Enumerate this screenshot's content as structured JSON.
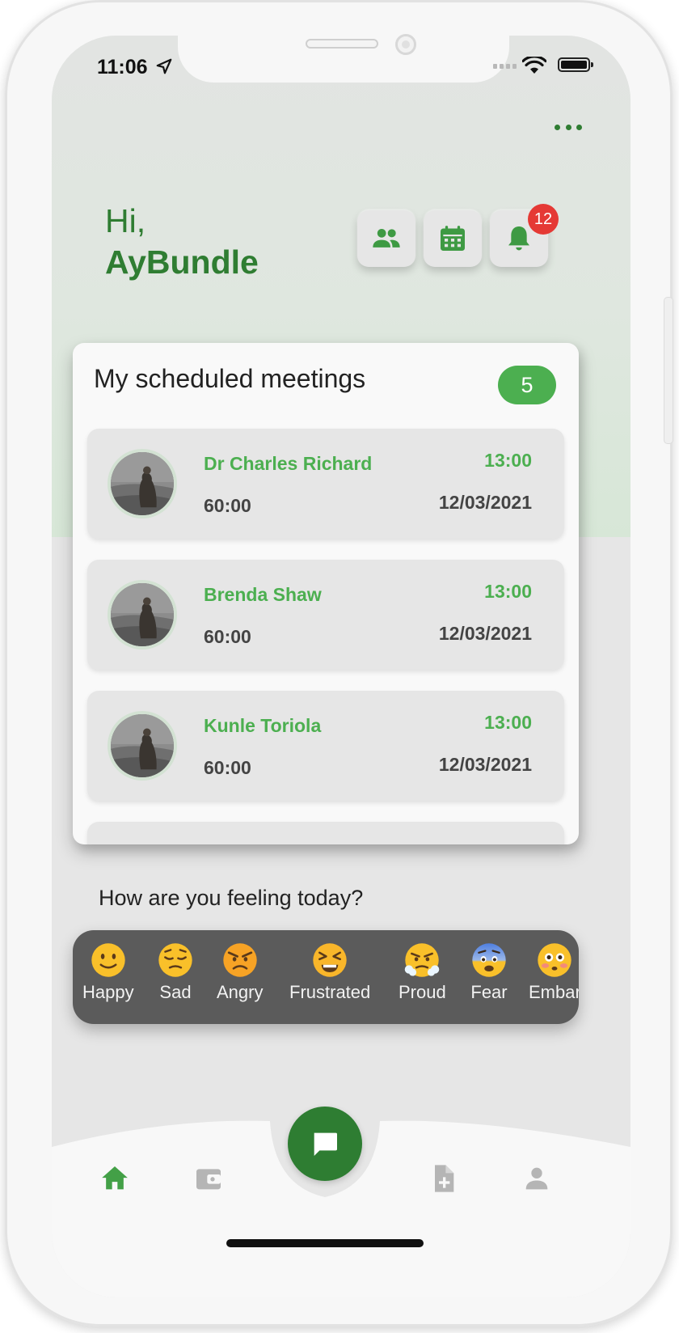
{
  "status_bar": {
    "time": "11:06"
  },
  "header": {
    "greeting": "Hi,",
    "user_name": "AyBundle",
    "notification_count": "12",
    "accent_color": "#2f7d32"
  },
  "meetings": {
    "title": "My scheduled meetings",
    "count": "5",
    "items": [
      {
        "name": "Dr Charles Richard",
        "duration": "60:00",
        "time": "13:00",
        "date": "12/03/2021"
      },
      {
        "name": "Brenda Shaw",
        "duration": "60:00",
        "time": "13:00",
        "date": "12/03/2021"
      },
      {
        "name": "Kunle Toriola",
        "duration": "60:00",
        "time": "13:00",
        "date": "12/03/2021"
      }
    ]
  },
  "feelings": {
    "title": "How are you feeling today?",
    "moods": [
      {
        "label": "Happy",
        "icon": "smile-emoji"
      },
      {
        "label": "Sad",
        "icon": "pensive-emoji"
      },
      {
        "label": "Angry",
        "icon": "angry-emoji"
      },
      {
        "label": "Frustrated",
        "icon": "tired-emoji"
      },
      {
        "label": "Proud",
        "icon": "triumph-emoji"
      },
      {
        "label": "Fear",
        "icon": "fearful-emoji"
      },
      {
        "label": "Embar",
        "icon": "flushed-emoji"
      }
    ]
  },
  "bottom_nav": {
    "items": [
      {
        "name": "home",
        "icon": "home-icon",
        "active": true
      },
      {
        "name": "wallet",
        "icon": "wallet-icon",
        "active": false
      },
      {
        "name": "chat",
        "icon": "chat-icon",
        "active": false
      },
      {
        "name": "add-document",
        "icon": "add-document-icon",
        "active": false
      },
      {
        "name": "profile",
        "icon": "person-icon",
        "active": false
      }
    ]
  }
}
